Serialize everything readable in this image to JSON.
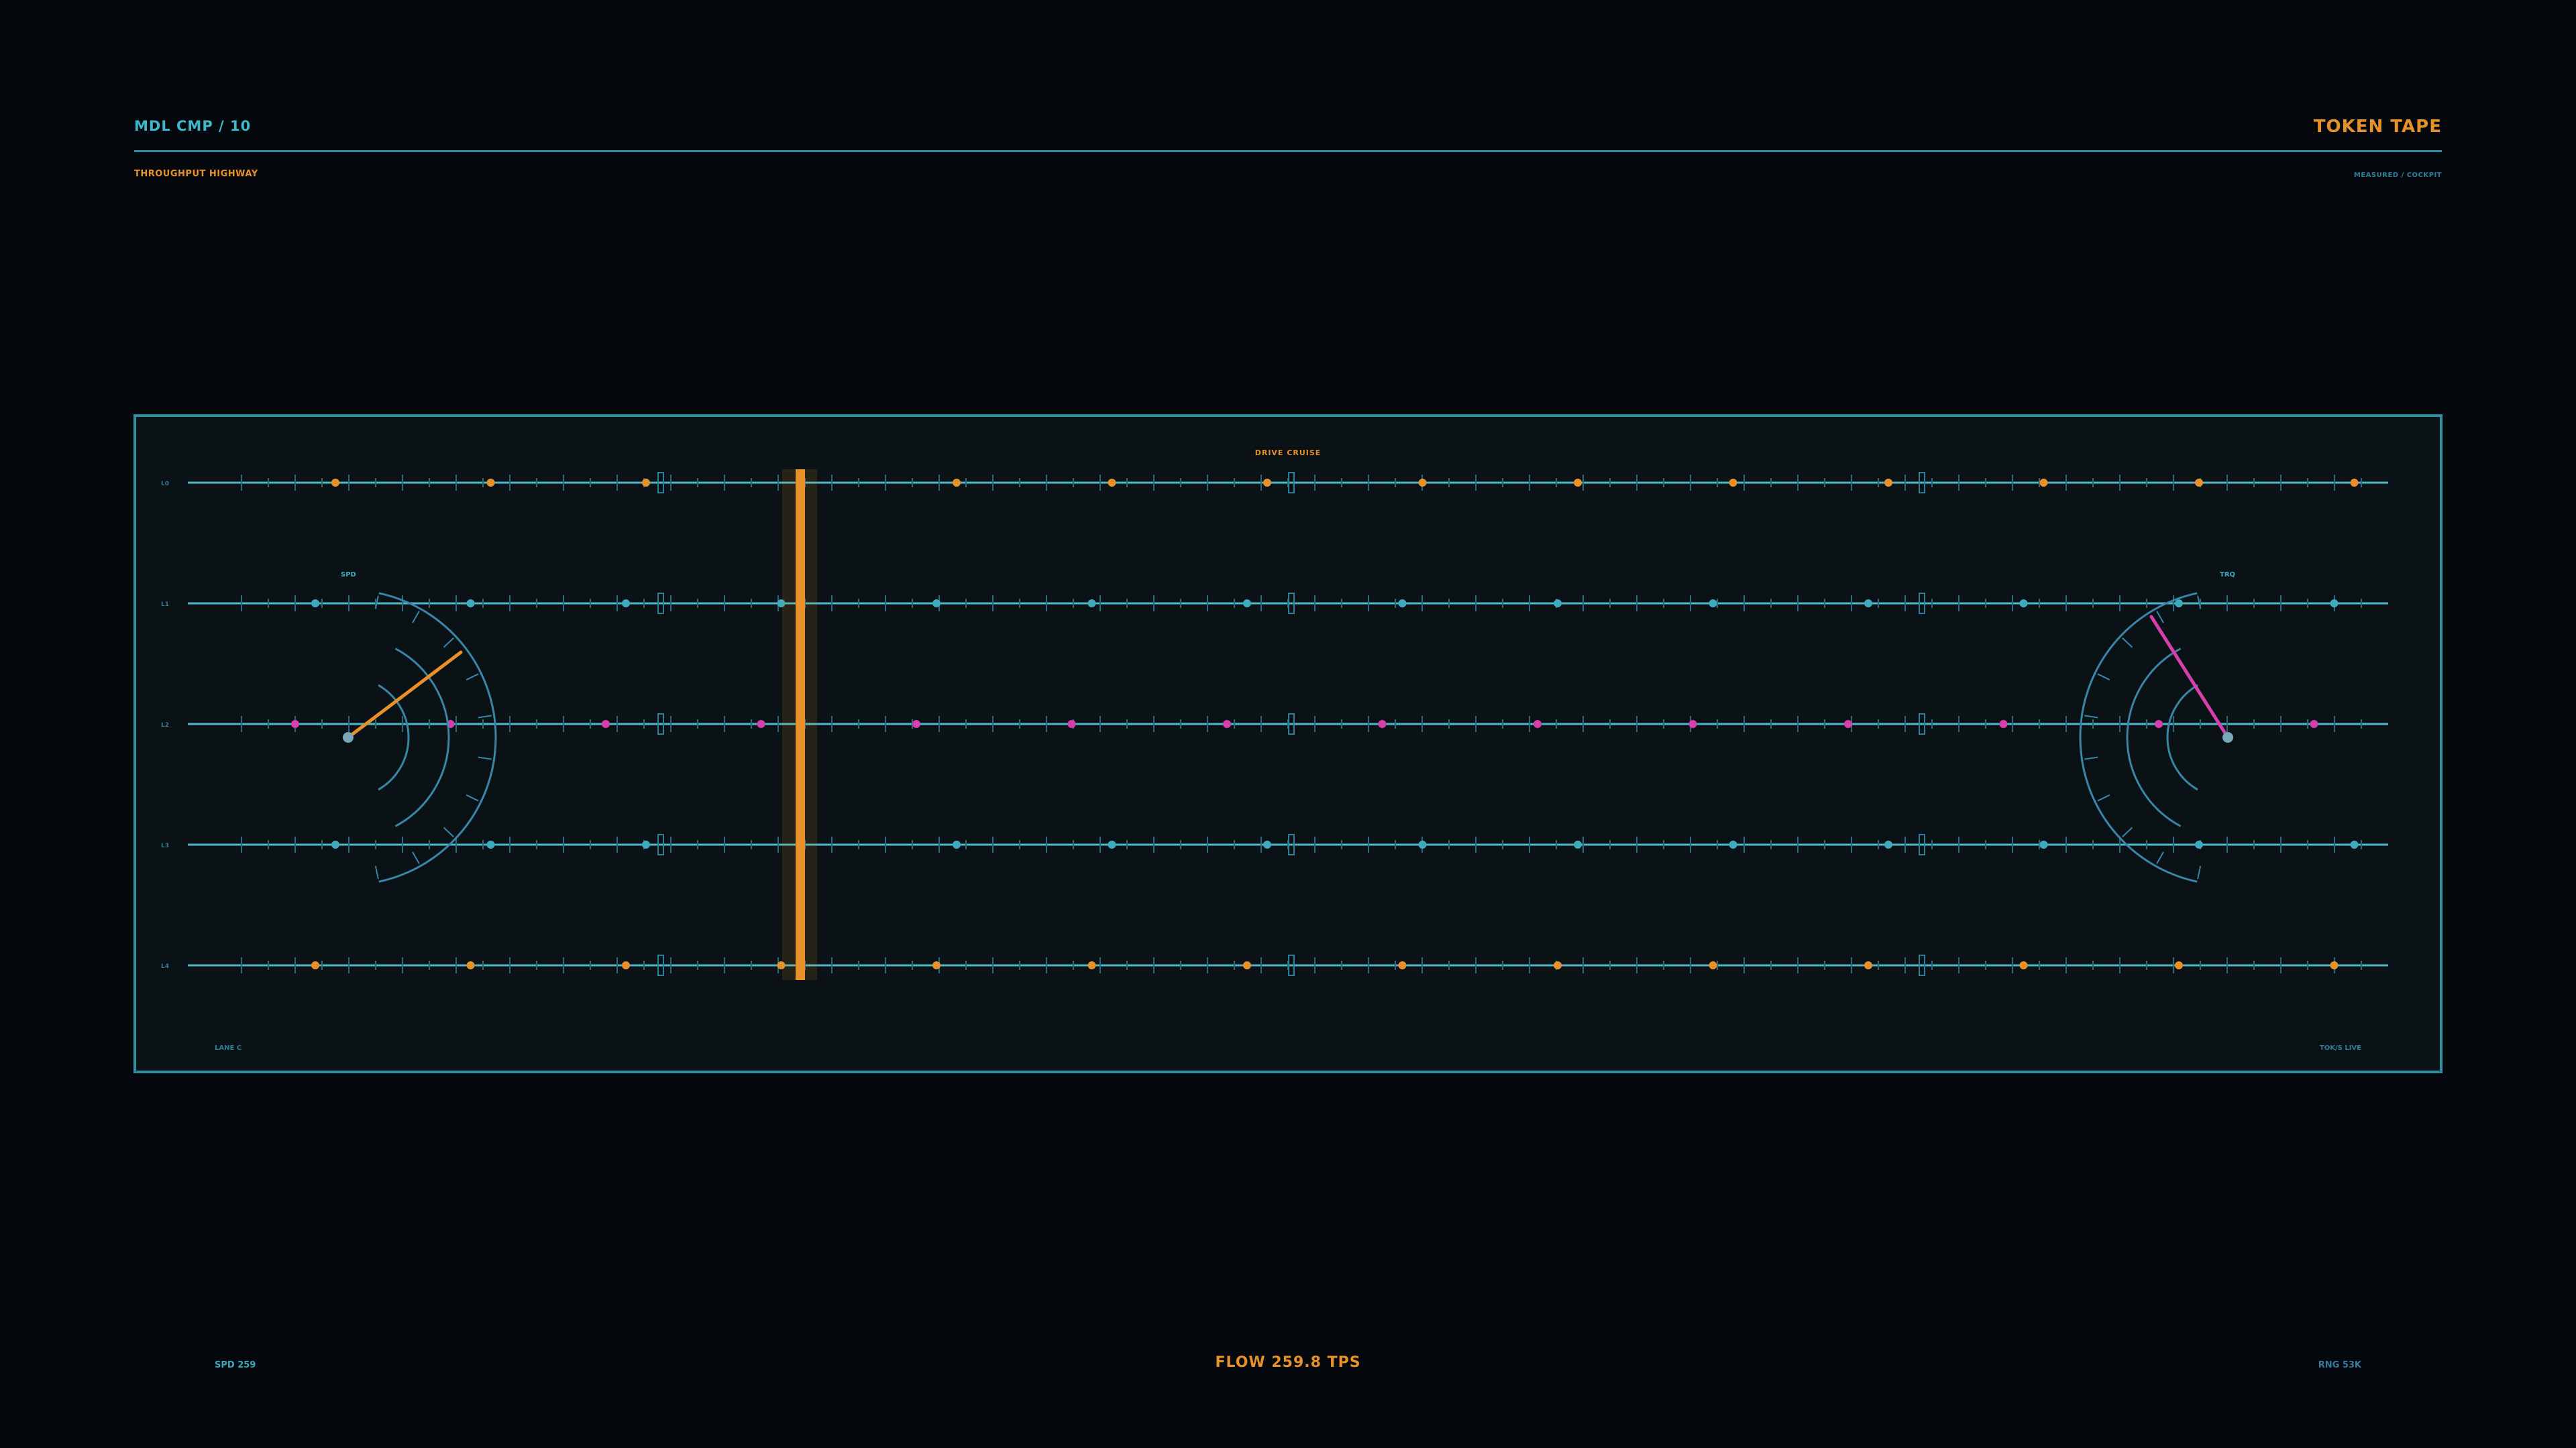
{
  "header": {
    "left_title": "MDL CMP / 10",
    "subtitle": "THROUGHPUT HIGHWAY",
    "right_title": "TOKEN TAPE",
    "right_subtitle": "MEASURED / COCKPIT"
  },
  "panel": {
    "mode_label": "DRIVE CRUISE",
    "bottom_left": "LANE C",
    "bottom_right": "TOK/S LIVE"
  },
  "lanes": [
    {
      "label": "L0",
      "color": "#e8902a"
    },
    {
      "label": "L1",
      "color": "#3fa9bd"
    },
    {
      "label": "L2",
      "color": "#d63fae"
    },
    {
      "label": "L3",
      "color": "#3fa9bd"
    },
    {
      "label": "L4",
      "color": "#e8902a"
    }
  ],
  "gauges": {
    "left": {
      "label": "SPD",
      "needle_color": "#e8902a"
    },
    "right": {
      "label": "TRQ",
      "needle_color": "#d63fae"
    }
  },
  "footer": {
    "left": "SPD 259",
    "center": "FLOW 259.8 TPS",
    "right": "RNG 53K"
  },
  "colors": {
    "background": "#05090d",
    "panel_bg": "#0a1216",
    "panel_border": "#2f8ea0",
    "lane_line": "#4db6c8",
    "gauge_arc": "#3a86a8",
    "accent_orange": "#e8902a",
    "accent_cyan": "#3fb8cc",
    "accent_magenta": "#d63fae",
    "muted_blue": "#3a7a9a"
  }
}
